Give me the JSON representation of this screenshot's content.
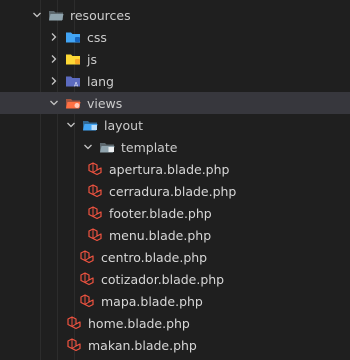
{
  "tree": [
    {
      "label": "resources",
      "type": "folder",
      "expanded": true,
      "depth": 0,
      "icon": "folder-open-icon",
      "color": "#90a4ae",
      "name": "folder-resources"
    },
    {
      "label": "css",
      "type": "folder",
      "expanded": false,
      "depth": 1,
      "icon": "folder-css-icon",
      "color": "#42a5f5",
      "name": "folder-css"
    },
    {
      "label": "js",
      "type": "folder",
      "expanded": false,
      "depth": 1,
      "icon": "folder-js-icon",
      "color": "#fdd835",
      "name": "folder-js"
    },
    {
      "label": "lang",
      "type": "folder",
      "expanded": false,
      "depth": 1,
      "icon": "folder-lang-icon",
      "color": "#5c6bc0",
      "name": "folder-lang"
    },
    {
      "label": "views",
      "type": "folder",
      "expanded": true,
      "depth": 1,
      "icon": "folder-views-icon",
      "color": "#ff7043",
      "name": "folder-views",
      "selected": true
    },
    {
      "label": "layout",
      "type": "folder",
      "expanded": true,
      "depth": 2,
      "icon": "folder-layout-icon",
      "color": "#42a5f5",
      "name": "folder-layout"
    },
    {
      "label": "template",
      "type": "folder",
      "expanded": true,
      "depth": 3,
      "icon": "folder-template-icon",
      "color": "#90a4ae",
      "name": "folder-template"
    },
    {
      "label": "apertura.blade.php",
      "type": "file",
      "depth": 4,
      "icon": "laravel-icon",
      "color": "#f05340",
      "name": "file-apertura-blade"
    },
    {
      "label": "cerradura.blade.php",
      "type": "file",
      "depth": 4,
      "icon": "laravel-icon",
      "color": "#f05340",
      "name": "file-cerradura-blade"
    },
    {
      "label": "footer.blade.php",
      "type": "file",
      "depth": 4,
      "icon": "laravel-icon",
      "color": "#f05340",
      "name": "file-footer-blade"
    },
    {
      "label": "menu.blade.php",
      "type": "file",
      "depth": 4,
      "icon": "laravel-icon",
      "color": "#f05340",
      "name": "file-menu-blade"
    },
    {
      "label": "centro.blade.php",
      "type": "file",
      "depth": 3,
      "icon": "laravel-icon",
      "color": "#f05340",
      "name": "file-centro-blade"
    },
    {
      "label": "cotizador.blade.php",
      "type": "file",
      "depth": 3,
      "icon": "laravel-icon",
      "color": "#f05340",
      "name": "file-cotizador-blade"
    },
    {
      "label": "mapa.blade.php",
      "type": "file",
      "depth": 3,
      "icon": "laravel-icon",
      "color": "#f05340",
      "name": "file-mapa-blade"
    },
    {
      "label": "home.blade.php",
      "type": "file",
      "depth": 2,
      "icon": "laravel-icon",
      "color": "#f05340",
      "name": "file-home-blade"
    },
    {
      "label": "makan.blade.php",
      "type": "file",
      "depth": 2,
      "icon": "laravel-icon",
      "color": "#f05340",
      "name": "file-makan-blade"
    }
  ]
}
